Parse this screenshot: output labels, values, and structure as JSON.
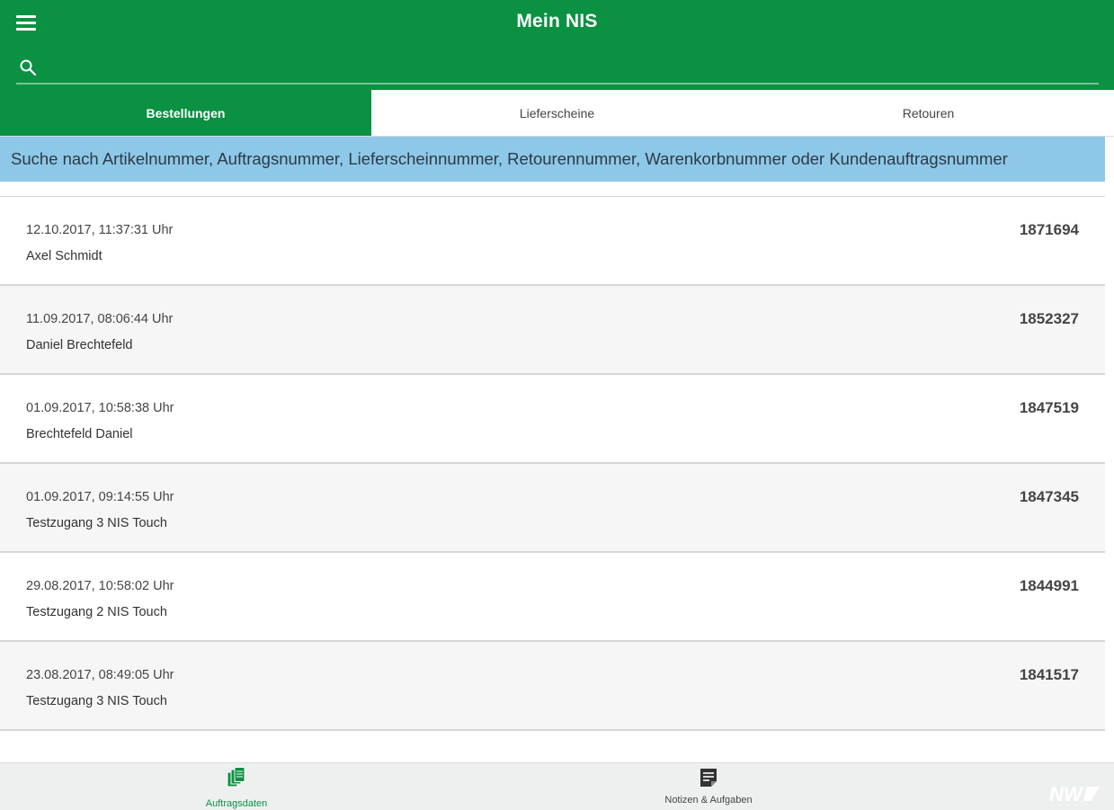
{
  "header": {
    "title": "Mein NIS",
    "menu_icon": "hamburger-menu-icon",
    "search": {
      "icon": "search-icon",
      "placeholder": "",
      "value": ""
    }
  },
  "tabs": [
    {
      "label": "Bestellungen",
      "active": true
    },
    {
      "label": "Lieferscheine",
      "active": false
    },
    {
      "label": "Retouren",
      "active": false
    }
  ],
  "hint": "Suche nach Artikelnummer, Auftragsnummer, Lieferscheinnummer, Retourennummer, Warenkorbnummer oder Kundenauftragsnummer",
  "orders": [
    {
      "date": "12.10.2017, 11:37:31 Uhr",
      "name": "Axel Schmidt",
      "number": "1871694"
    },
    {
      "date": "11.09.2017, 08:06:44 Uhr",
      "name": "Daniel Brechtefeld",
      "number": "1852327"
    },
    {
      "date": "01.09.2017, 10:58:38 Uhr",
      "name": "Brechtefeld Daniel",
      "number": "1847519"
    },
    {
      "date": "01.09.2017, 09:14:55 Uhr",
      "name": "Testzugang 3 NIS Touch",
      "number": "1847345"
    },
    {
      "date": "29.08.2017, 10:58:02 Uhr",
      "name": "Testzugang 2 NIS Touch",
      "number": "1844991"
    },
    {
      "date": "23.08.2017, 08:49:05 Uhr",
      "name": "Testzugang 3 NIS Touch",
      "number": "1841517"
    },
    {
      "date": "",
      "name": "",
      "number": ""
    }
  ],
  "bottom_nav": [
    {
      "label": "Auftragsdaten",
      "icon": "documents-stack-icon",
      "active": true
    },
    {
      "label": "Notizen & Aufgaben",
      "icon": "notes-icon",
      "active": false
    }
  ],
  "brand": {
    "logo": "NW-logo",
    "logo_text": "NW"
  },
  "colors": {
    "primary": "#0a9142",
    "hint_bg": "#8dc8e8",
    "bottom_bg": "#eef0f0"
  }
}
